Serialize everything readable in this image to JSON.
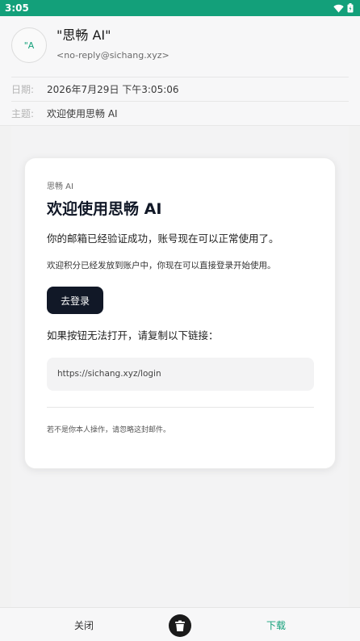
{
  "status_bar": {
    "time": "3:05",
    "color": "#13a07a"
  },
  "header": {
    "avatar_text": "\"A",
    "sender_name": "\"思畅 AI\"",
    "sender_email": "<no-reply@sichang.xyz>",
    "date_label": "日期:",
    "date_value": "2026年7月29日 下午3:05:06",
    "subject_label": "主题:",
    "subject_value": "欢迎使用思畅 AI"
  },
  "email": {
    "brand": "思畅 AI",
    "title": "欢迎使用思畅 AI",
    "paragraph1": "你的邮箱已经验证成功，账号现在可以正常使用了。",
    "paragraph2": "欢迎积分已经发放到账户中，你现在可以直接登录开始使用。",
    "login_button": "去登录",
    "link_prompt": "如果按钮无法打开，请复制以下链接：",
    "link_url": "https://sichang.xyz/login",
    "footer_note": "若不是你本人操作，请忽略这封邮件。"
  },
  "bottom_bar": {
    "close_label": "关闭",
    "trash_icon": "trash-icon",
    "download_label": "下载",
    "accent_color": "#13a07a"
  }
}
